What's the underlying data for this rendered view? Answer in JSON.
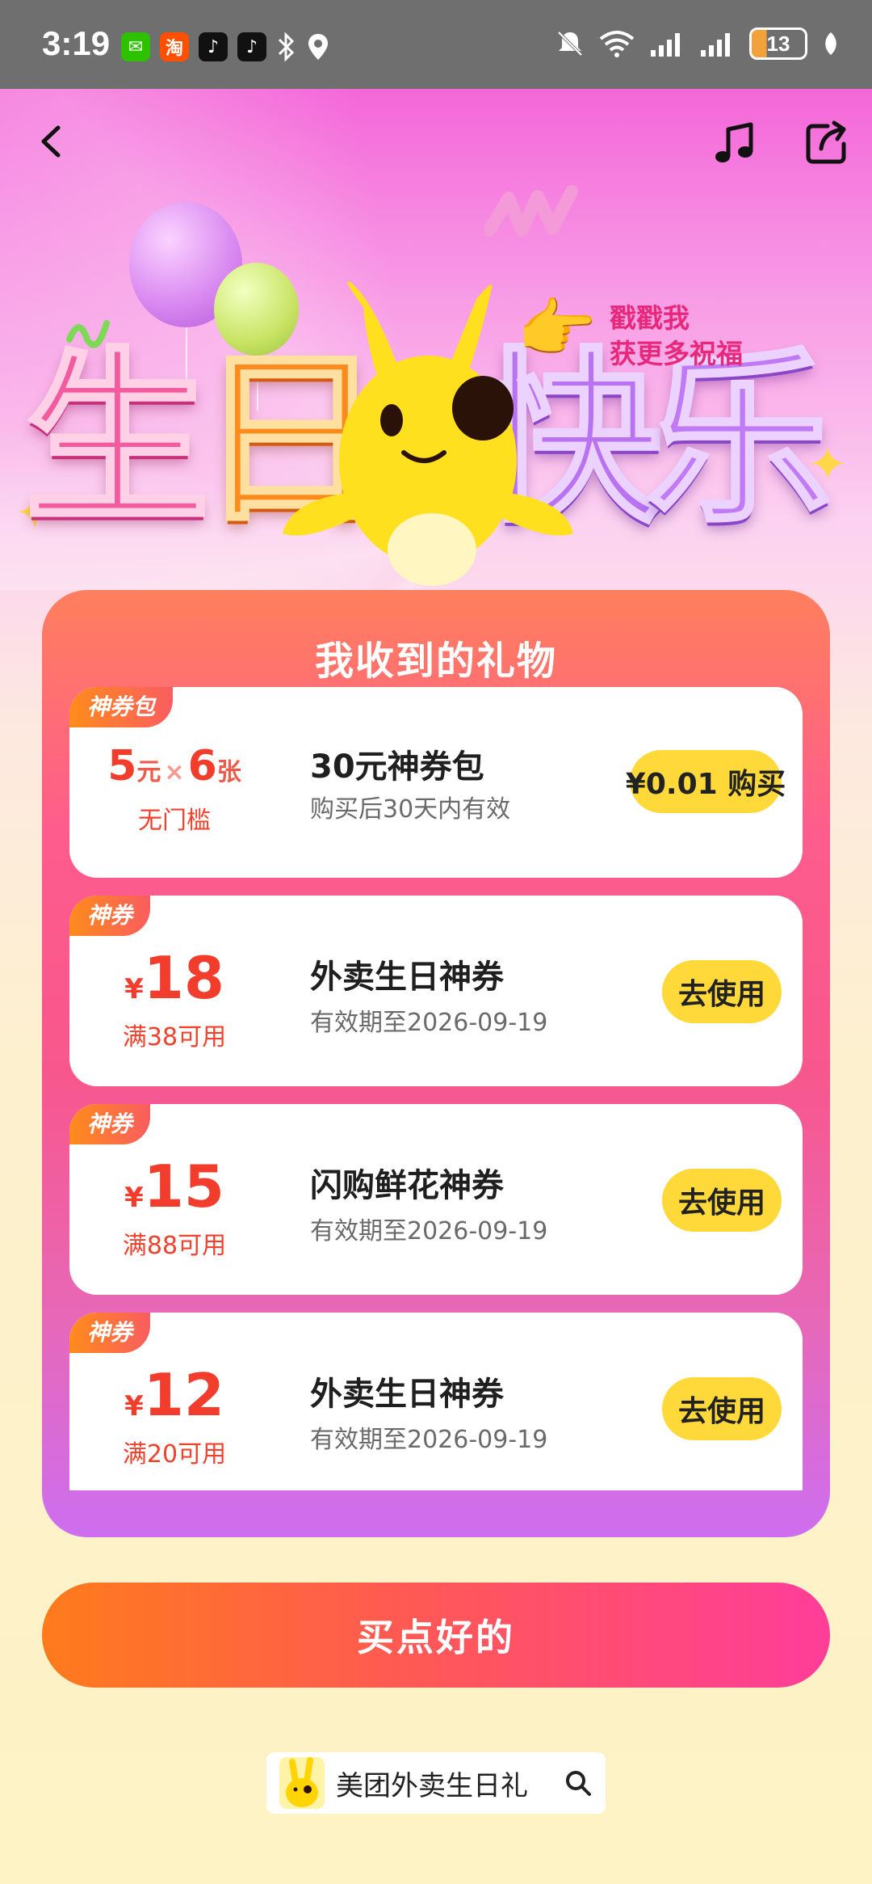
{
  "status_bar": {
    "time": "3:19",
    "apps": [
      {
        "icon": "wechat-icon",
        "glyph": "✉",
        "color": "#2dc100"
      },
      {
        "icon": "taobao-icon",
        "glyph": "淘",
        "color": "#ff5000"
      },
      {
        "icon": "tiktok-icon",
        "glyph": "♪",
        "color": "#111111"
      },
      {
        "icon": "tiktok-icon",
        "glyph": "♪",
        "color": "#111111"
      }
    ],
    "battery": "13"
  },
  "banner": {
    "title_chars": [
      "生",
      "日",
      "快",
      "乐"
    ],
    "poke_line1": "戳戳我",
    "poke_line2": "获更多祝福"
  },
  "gifts": {
    "title": "我收到的礼物",
    "pack": {
      "tag": "神券包",
      "amount": "5",
      "amount_unit": "元",
      "times": "×",
      "count": "6",
      "count_unit": "张",
      "condition": "无门槛",
      "name": "30元神券包",
      "desc": "购买后30天内有效",
      "button": "¥0.01 购买"
    },
    "coupons": [
      {
        "tag": "神券",
        "yen": "¥",
        "amount": "18",
        "condition": "满38可用",
        "name": "外卖生日神券",
        "desc": "有效期至2026-09-19",
        "button": "去使用"
      },
      {
        "tag": "神券",
        "yen": "¥",
        "amount": "15",
        "condition": "满88可用",
        "name": "闪购鲜花神券",
        "desc": "有效期至2026-09-19",
        "button": "去使用"
      },
      {
        "tag": "神券",
        "yen": "¥",
        "amount": "12",
        "condition": "满20可用",
        "name": "外卖生日神券",
        "desc": "有效期至2026-09-19",
        "button": "去使用"
      }
    ]
  },
  "cta": {
    "label": "买点好的"
  },
  "search_chip": {
    "label": "美团外卖生日礼"
  },
  "colors": {
    "accent_yellow": "#ffd93a",
    "price_red": "#f23d2c",
    "cta_start": "#ff7b1b",
    "cta_end": "#ff3d9a"
  }
}
